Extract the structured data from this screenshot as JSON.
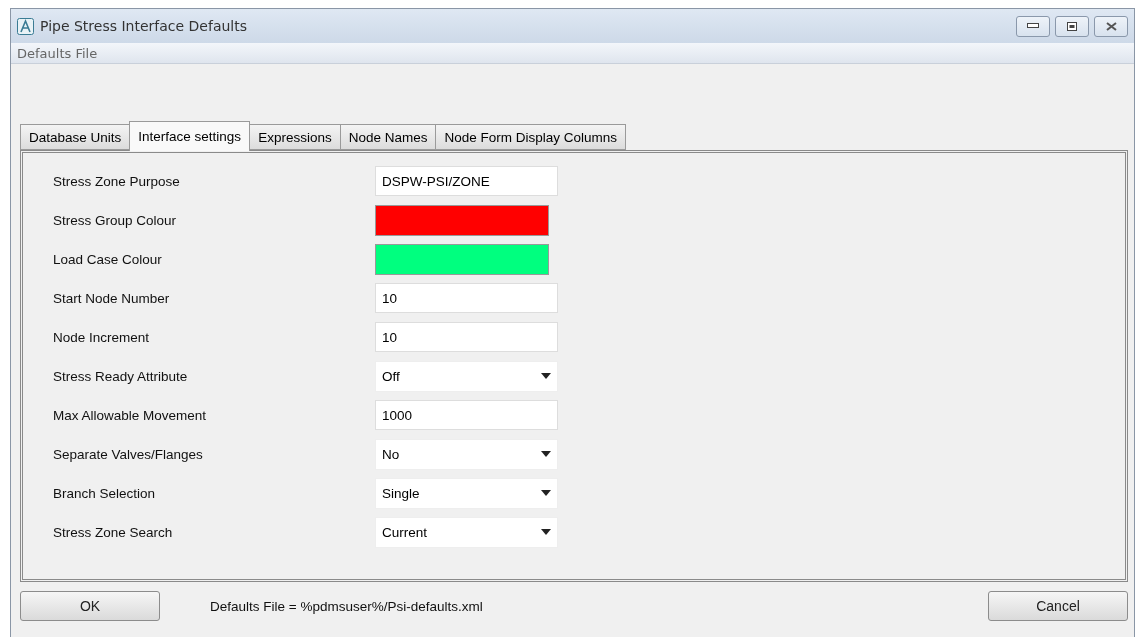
{
  "window": {
    "title": "Pipe Stress Interface Defaults"
  },
  "menu": [
    "Defaults File"
  ],
  "tabs": [
    {
      "label": "Database Units",
      "selected": false
    },
    {
      "label": "Interface settings",
      "selected": true
    },
    {
      "label": "Expressions",
      "selected": false
    },
    {
      "label": "Node Names",
      "selected": false
    },
    {
      "label": "Node Form Display Columns",
      "selected": false
    }
  ],
  "fields": [
    {
      "label": "Stress Zone Purpose",
      "kind": "text",
      "value": "DSPW-PSI/ZONE"
    },
    {
      "label": "Stress Group Colour",
      "kind": "color",
      "color": "#ff0000"
    },
    {
      "label": "Load Case Colour",
      "kind": "color",
      "color": "#00ff7f"
    },
    {
      "label": "Start Node Number",
      "kind": "text",
      "value": "10"
    },
    {
      "label": "Node Increment",
      "kind": "text",
      "value": "10"
    },
    {
      "label": "Stress Ready Attribute",
      "kind": "dropdown",
      "value": "Off"
    },
    {
      "label": "Max Allowable Movement",
      "kind": "text",
      "value": "1000"
    },
    {
      "label": "Separate Valves/Flanges",
      "kind": "dropdown",
      "value": "No"
    },
    {
      "label": "Branch Selection",
      "kind": "dropdown",
      "value": "Single"
    },
    {
      "label": "Stress Zone Search",
      "kind": "dropdown",
      "value": "Current"
    }
  ],
  "footer": {
    "ok": "OK",
    "status": "Defaults File = %pdmsuser%/Psi-defaults.xml",
    "cancel": "Cancel"
  }
}
